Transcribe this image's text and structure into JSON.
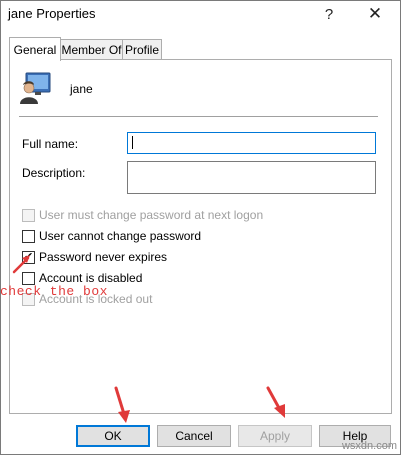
{
  "window": {
    "title": "jane Properties",
    "help_glyph": "?",
    "close_glyph": "✕"
  },
  "tabs": [
    {
      "label": "General",
      "active": true
    },
    {
      "label": "Member Of",
      "active": false
    },
    {
      "label": "Profile",
      "active": false
    }
  ],
  "user": {
    "name": "jane"
  },
  "fields": {
    "full_name": {
      "label": "Full name:",
      "value": ""
    },
    "description": {
      "label": "Description:",
      "value": ""
    }
  },
  "checkboxes": [
    {
      "label": "User must change password at next logon",
      "checked": false,
      "enabled": false
    },
    {
      "label": "User cannot change password",
      "checked": false,
      "enabled": true
    },
    {
      "label": "Password never expires",
      "checked": true,
      "enabled": true
    },
    {
      "label": "Account is disabled",
      "checked": false,
      "enabled": true
    },
    {
      "label": "Account is locked out",
      "checked": false,
      "enabled": false
    }
  ],
  "annotation": {
    "text": "check the box",
    "color": "#e03a3a"
  },
  "buttons": {
    "ok": "OK",
    "cancel": "Cancel",
    "apply": "Apply",
    "help": "Help"
  },
  "watermark": "wsxdn.com",
  "colors": {
    "accent": "#0078d7",
    "annotation_red": "#e03a3a"
  }
}
